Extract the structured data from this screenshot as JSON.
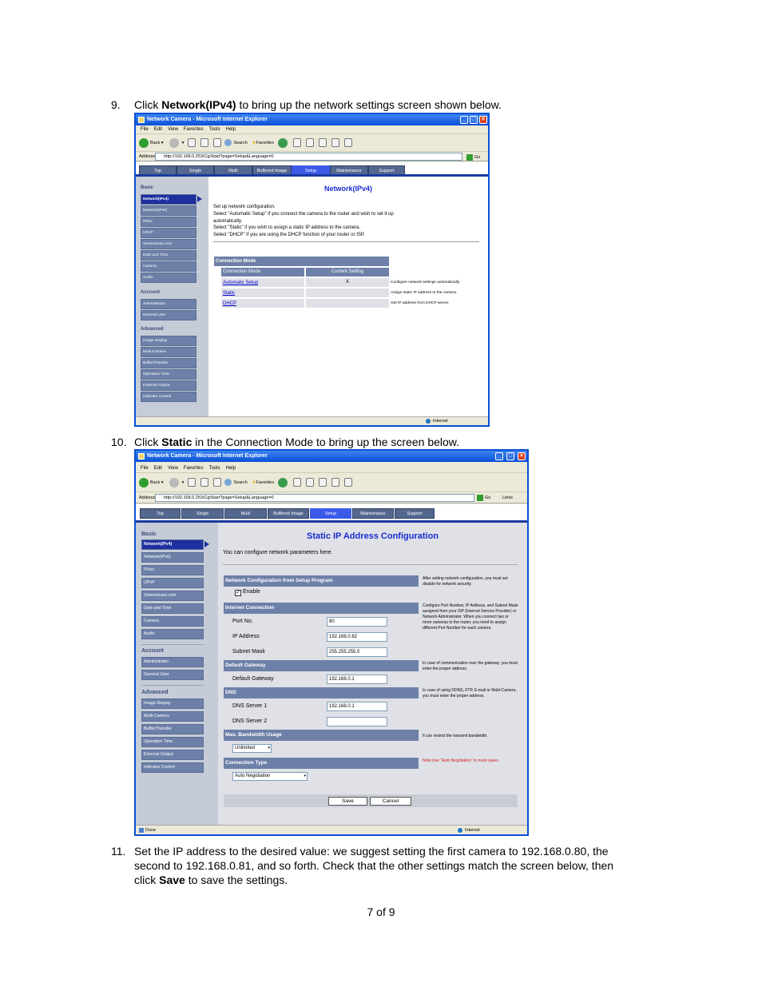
{
  "steps": [
    {
      "num": "9.",
      "pre": "Click ",
      "bold": "Network(IPv4)",
      "post": " to bring up the network settings screen shown below."
    },
    {
      "num": "10.",
      "pre": "Click ",
      "bold": "Static",
      "post": " in the Connection Mode to bring up the screen below."
    },
    {
      "num": "11.",
      "line1": "Set the IP address to the desired value: we suggest setting the first camera to 192.168.0.80, the",
      "line2": "second to 192.168.0.81, and so forth. Check that the other settings match the screen below, then",
      "line3_pre": "click ",
      "line3_bold": "Save",
      "line3_post": " to save the settings."
    }
  ],
  "page_number": "7 of 9",
  "browser": {
    "title": "Network Camera - Microsoft Internet Explorer",
    "menu": [
      "File",
      "Edit",
      "View",
      "Favorites",
      "Tools",
      "Help"
    ],
    "toolbar": {
      "back": "Back",
      "search": "Search",
      "favorites": "Favorites"
    },
    "address_label": "Address",
    "address": "http://192.168.0.253/CgiStart?page=Setup&Language=0",
    "go": "Go",
    "links": "Links"
  },
  "nav_tabs": [
    "Top",
    "Single",
    "Multi",
    "Buffered Image",
    "Setup",
    "Maintenance",
    "Support"
  ],
  "sidebar": {
    "basic_head": "Basic",
    "basic": [
      "Network(IPv4)",
      "Network(IPv6)",
      "IPsec",
      "UPnP",
      "Viewnetcam.com",
      "Date and Time",
      "Camera",
      "Audio"
    ],
    "account_head": "Account",
    "account": [
      "Administrator",
      "General User"
    ],
    "advanced_head": "Advanced",
    "advanced": [
      "Image Display",
      "Multi-Camera",
      "Buffer/Transfer",
      "Operation Time",
      "External Output",
      "Indicator Control"
    ]
  },
  "shot1": {
    "heading": "Network(IPv4)",
    "intro": [
      "Set up network configuration.",
      "Select \"Automatic Setup\" if you connect the camera to the router and wish to set it up",
      "automatically.",
      "Select \"Static\" if you wish to assign a static IP address to the camera.",
      "Select \"DHCP\" if you are using the DHCP function of your router or ISP."
    ],
    "section": "Connection Mode",
    "col1": "Connection Mode",
    "col2": "Current Setting",
    "rows": [
      {
        "mode": "Automatic Setup",
        "current": "X",
        "desc": "Configure network settings automatically."
      },
      {
        "mode": "Static",
        "current": "",
        "desc": "Assign static IP address to the camera."
      },
      {
        "mode": "DHCP",
        "current": "",
        "desc": "Get IP address from DHCP server."
      }
    ],
    "status_right": "Internet"
  },
  "shot2": {
    "heading": "Static IP Address Configuration",
    "intro": "You can configure network parameters here.",
    "setup_section": "Network Configuration from Setup Program",
    "enable": "Enable",
    "setup_note": "After setting network configuration, you must set disable for network security.",
    "internet_section": "Internet Connection",
    "port_label": "Port No.",
    "port_value": "80",
    "ip_label": "IP Address",
    "ip_value": "192.168.0.82",
    "mask_label": "Subnet Mask",
    "mask_value": "255.255.255.0",
    "internet_note": "Configure Port Number, IP Address, and Subnet Mask assigned from your ISP (Internet Service Provider) or Network Administrator. When you connect two or more cameras to the router, you need to assign different Port Number for each camera.",
    "gateway_section": "Default Gateway",
    "gateway_label": "Default Gateway",
    "gateway_value": "192.168.0.1",
    "gateway_note": "In case of communication over the gateway, you must enter the proper address.",
    "dns_section": "DNS",
    "dns1_label": "DNS Server 1",
    "dns1_value": "192.168.0.1",
    "dns2_label": "DNS Server 2",
    "dns2_value": "",
    "dns_note": "In case of using DDNS, FTP, E-mail or Multi-Camera, you must enter the proper address.",
    "bandwidth_section": "Max. Bandwidth Usage",
    "bandwidth_value": "Unlimited",
    "bandwidth_note": "It can restrict the transmit bandwidth.",
    "conn_section": "Connection Type",
    "conn_value": "Auto Negotiation",
    "conn_note": "Note:Use \"Auto Negotiation\" in most cases.",
    "save": "Save",
    "cancel": "Cancel",
    "status_left": "Done",
    "status_right": "Internet"
  },
  "colors": {
    "accent": "#1a2bd1",
    "section": "#6d80a8",
    "window_border": "#0a4fd8",
    "note_red": "#d8191d"
  }
}
